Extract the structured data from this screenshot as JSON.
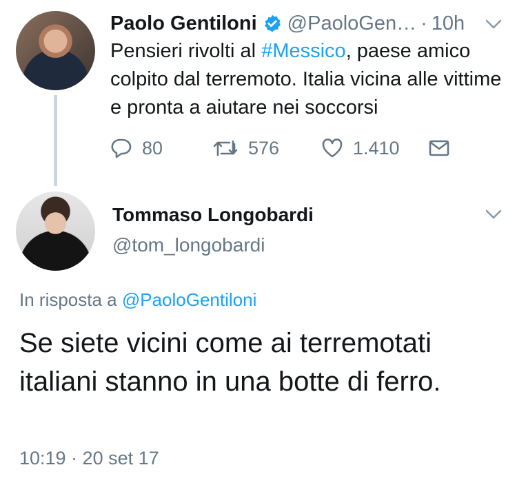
{
  "tweet1": {
    "author_name": "Paolo Gentiloni",
    "author_handle": "@PaoloGen…",
    "separator": "·",
    "time": "10h",
    "text_before": "Pensieri rivolti al ",
    "hashtag": "#Messico",
    "text_after": ", paese amico colpito dal terremoto. Italia vicina alle vittime e pronta a aiutare nei soccorsi",
    "actions": {
      "replies": "80",
      "retweets": "576",
      "likes": "1.410"
    },
    "verified": true
  },
  "tweet2": {
    "author_name": "Tommaso Longobardi",
    "author_handle": "@tom_longobardi",
    "reply_prefix": "In risposta a ",
    "reply_mention": "@PaoloGentiloni",
    "text": "Se siete vicini come ai terremotati italiani stanno in una botte di ferro.",
    "timestamp": "10:19 · 20 set 17"
  },
  "icons": {
    "verified": "verified-badge-icon",
    "chevron": "chevron-down-icon",
    "reply": "reply-bubble-icon",
    "retweet": "retweet-icon",
    "like": "heart-icon",
    "dm": "envelope-icon"
  },
  "colors": {
    "accent": "#1da1f2",
    "secondary_text": "#657786",
    "primary_text": "#14171a",
    "thread_line": "#ccd6dd"
  }
}
